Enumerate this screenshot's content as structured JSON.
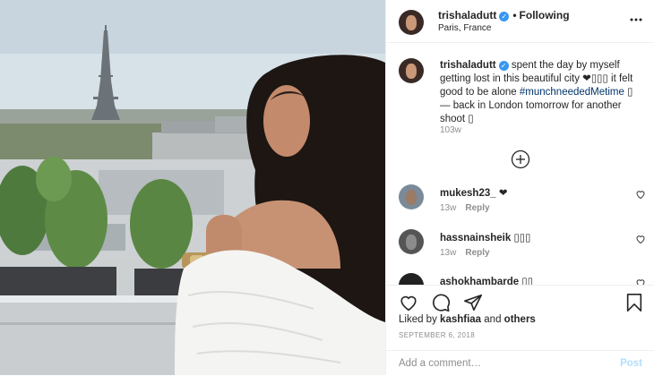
{
  "header": {
    "username": "trishaladutt",
    "verified_glyph": "✓",
    "separator": "•",
    "follow_label": "Following",
    "location": "Paris, France"
  },
  "caption": {
    "username": "trishaladutt",
    "text_1": "spent the day by myself getting lost in this beautiful city ❤",
    "emoji_1": "▯▯▯",
    "text_2": " it felt good to be alone ",
    "hashtag": "#munchneededMetime",
    "text_3": " ▯— back in London tomorrow for another shoot ▯",
    "time": "103w"
  },
  "comments": [
    {
      "username": "mukesh23_",
      "text": "❤",
      "time": "13w",
      "reply_label": "Reply"
    },
    {
      "username": "hassnainsheik",
      "text": "▯▯▯",
      "time": "13w",
      "reply_label": "Reply"
    },
    {
      "username": "ashokhambarde",
      "text": "▯▯",
      "time": "",
      "reply_label": ""
    }
  ],
  "likes": {
    "prefix": "Liked by",
    "user": "kashfiaa",
    "joiner": "and",
    "rest": "others"
  },
  "date": "SEPTEMBER 6, 2018",
  "add_comment": {
    "placeholder": "Add a comment…",
    "post_label": "Post"
  },
  "icons": [
    "more-icon",
    "plus-circle-icon",
    "heart-icon",
    "comment-icon",
    "share-icon",
    "bookmark-icon",
    "verified-badge-icon"
  ],
  "colors": {
    "verified": "#3897f0",
    "hashtag": "#003569",
    "muted": "#8e8e8e",
    "post_disabled": "#b2dffc"
  }
}
